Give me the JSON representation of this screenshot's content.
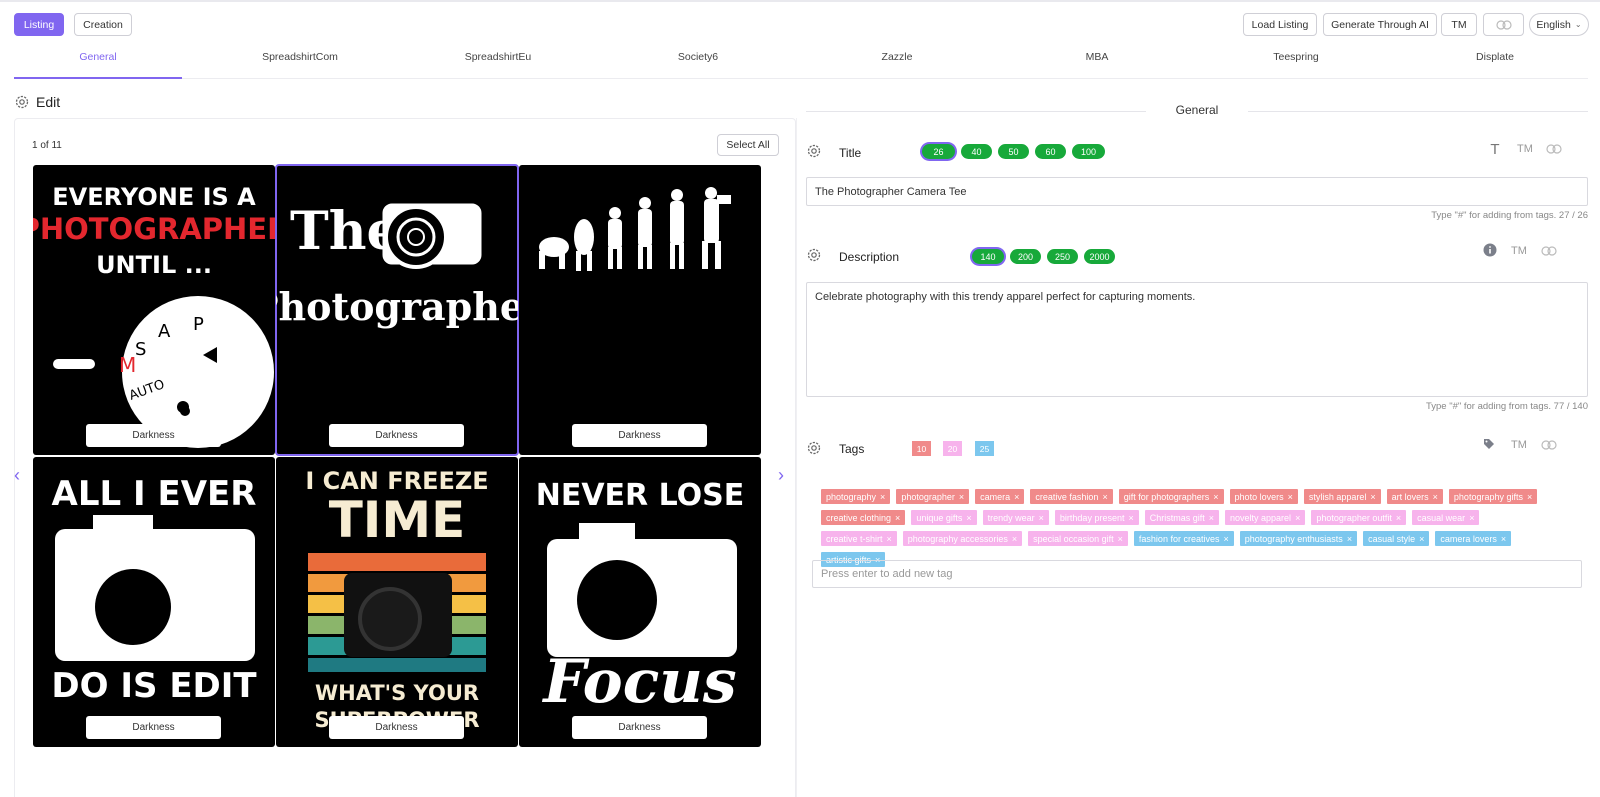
{
  "topbar": {
    "listing_label": "Listing",
    "creation_label": "Creation",
    "load_listing_label": "Load Listing",
    "generate_ai_label": "Generate Through AI",
    "tm_label": "TM",
    "language": "English"
  },
  "tabs": [
    "General",
    "SpreadshirtCom",
    "SpreadshirtEu",
    "Society6",
    "Zazzle",
    "MBA",
    "Teespring",
    "Displate"
  ],
  "edit": {
    "title": "Edit",
    "count": "1 of 11",
    "select_all": "Select All",
    "designs": [
      {
        "lines": [
          "EVERYONE IS A",
          "PHOTOGRAPHER",
          "UNTIL ..."
        ],
        "dial": [
          "P",
          "A",
          "S",
          "M",
          "AUTO"
        ],
        "label": "Darkness"
      },
      {
        "lines": [
          "The",
          "Photographer"
        ],
        "label": "Darkness"
      },
      {
        "lines": [],
        "label": "Darkness"
      },
      {
        "lines": [
          "ALL I EVER",
          "DO IS EDIT"
        ],
        "label": "Darkness"
      },
      {
        "lines": [
          "I CAN FREEZE",
          "TIME",
          "WHAT'S YOUR",
          "SUPERPOWER"
        ],
        "label": "Darkness"
      },
      {
        "lines": [
          "NEVER LOSE",
          "Focus"
        ],
        "label": "Darkness"
      }
    ]
  },
  "general": {
    "heading": "General",
    "title": {
      "label": "Title",
      "lengths": [
        "26",
        "40",
        "50",
        "60",
        "100"
      ],
      "selected": "26",
      "value": "The Photographer Camera Tee",
      "hint": "Type \"#\" for adding from tags. 27 / 26",
      "tm": "TM"
    },
    "description": {
      "label": "Description",
      "lengths": [
        "140",
        "200",
        "250",
        "2000"
      ],
      "selected": "140",
      "value": "Celebrate photography with this trendy apparel perfect for capturing moments.",
      "hint": "Type \"#\" for adding from tags. 77 / 140",
      "tm": "TM"
    },
    "tags": {
      "label": "Tags",
      "limits": [
        "10",
        "20",
        "25"
      ],
      "tm": "TM",
      "placeholder": "Press enter to add new tag",
      "items": [
        {
          "text": "photography",
          "color": "red"
        },
        {
          "text": "photographer",
          "color": "red"
        },
        {
          "text": "camera",
          "color": "red"
        },
        {
          "text": "creative fashion",
          "color": "red"
        },
        {
          "text": "gift for photographers",
          "color": "red"
        },
        {
          "text": "photo lovers",
          "color": "red"
        },
        {
          "text": "stylish apparel",
          "color": "red"
        },
        {
          "text": "art lovers",
          "color": "red"
        },
        {
          "text": "photography gifts",
          "color": "red"
        },
        {
          "text": "creative clothing",
          "color": "red"
        },
        {
          "text": "unique gifts",
          "color": "pink"
        },
        {
          "text": "trendy wear",
          "color": "pink"
        },
        {
          "text": "birthday present",
          "color": "pink"
        },
        {
          "text": "Christmas gift",
          "color": "pink"
        },
        {
          "text": "novelty apparel",
          "color": "pink"
        },
        {
          "text": "photographer outfit",
          "color": "pink"
        },
        {
          "text": "casual wear",
          "color": "pink"
        },
        {
          "text": "creative t-shirt",
          "color": "pink"
        },
        {
          "text": "photography accessories",
          "color": "pink"
        },
        {
          "text": "special occasion gift",
          "color": "pink"
        },
        {
          "text": "fashion for creatives",
          "color": "blue"
        },
        {
          "text": "photography enthusiasts",
          "color": "blue"
        },
        {
          "text": "casual style",
          "color": "blue"
        },
        {
          "text": "camera lovers",
          "color": "blue"
        },
        {
          "text": "artistic gifts",
          "color": "blue"
        }
      ]
    }
  },
  "colors": {
    "accent": "#8066f0",
    "green": "#17a93a",
    "tag_red": "#f08a8a",
    "tag_pink": "#f7b3ec",
    "tag_blue": "#7cc7ee"
  }
}
